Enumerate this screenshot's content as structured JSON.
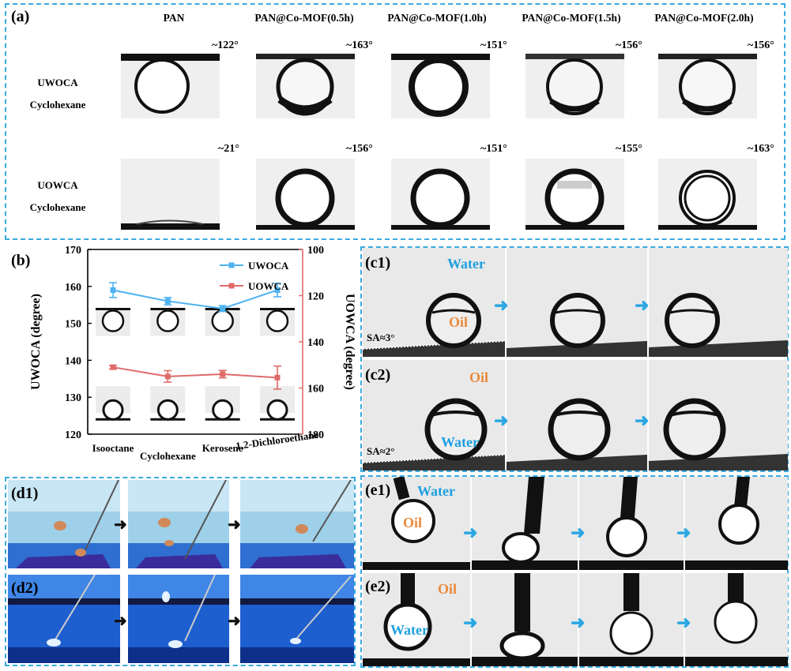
{
  "panel_a": {
    "label": "(a)",
    "columns": [
      "PAN",
      "PAN@Co-MOF(0.5h)",
      "PAN@Co-MOF(1.0h)",
      "PAN@Co-MOF(1.5h)",
      "PAN@Co-MOF(2.0h)"
    ],
    "rows": [
      {
        "name": "UWOCA",
        "liquid": "Cyclohexane",
        "angles": [
          "~122°",
          "~163°",
          "~151°",
          "~156°",
          "~156°"
        ]
      },
      {
        "name": "UOWCA",
        "liquid": "Cyclohexane",
        "angles": [
          "~21°",
          "~156°",
          "~151°",
          "~155°",
          "~163°"
        ]
      }
    ]
  },
  "panel_b": {
    "label": "(b)",
    "chart_data": {
      "type": "line",
      "categories": [
        "Isooctane",
        "Cyclohexane",
        "Kerosene",
        "1,2-Dichloroethane"
      ],
      "ylabel": "UWOCA (degree)",
      "ylabel_right": "UOWCA (degree)",
      "ylim": [
        120,
        170
      ],
      "ylim_right": [
        180,
        100
      ],
      "yticks": [
        120,
        130,
        140,
        150,
        160,
        170
      ],
      "yticks_right": [
        100,
        120,
        140,
        160,
        180
      ],
      "series": [
        {
          "name": "UWOCA",
          "axis": "left",
          "color": "#4eb3f0",
          "values": [
            159,
            156,
            154,
            159
          ],
          "errors": [
            2,
            1,
            0.8,
            1.8
          ]
        },
        {
          "name": "UOWCA",
          "axis": "right",
          "color": "#e06a6a",
          "values": [
            151,
            155,
            154,
            155.5
          ],
          "errors": [
            0.8,
            2.5,
            1.6,
            5
          ]
        }
      ]
    }
  },
  "panel_c": {
    "c1": {
      "label": "(c1)",
      "outer": "Water",
      "drop": "Oil",
      "sa": "SA≈3°"
    },
    "c2": {
      "label": "(c2)",
      "outer": "Oil",
      "drop": "Water",
      "sa": "SA≈2°"
    }
  },
  "panel_d": {
    "d1": {
      "label": "(d1)"
    },
    "d2": {
      "label": "(d2)"
    }
  },
  "panel_e": {
    "e1": {
      "label": "(e1)",
      "outer": "Water",
      "drop": "Oil"
    },
    "e2": {
      "label": "(e2)",
      "outer": "Oil",
      "drop": "Water"
    }
  },
  "colors": {
    "border": "#39a9e0",
    "arrow": "#2aa7e2",
    "water_label": "#1ea0e0",
    "oil_label": "#e98a3a"
  }
}
